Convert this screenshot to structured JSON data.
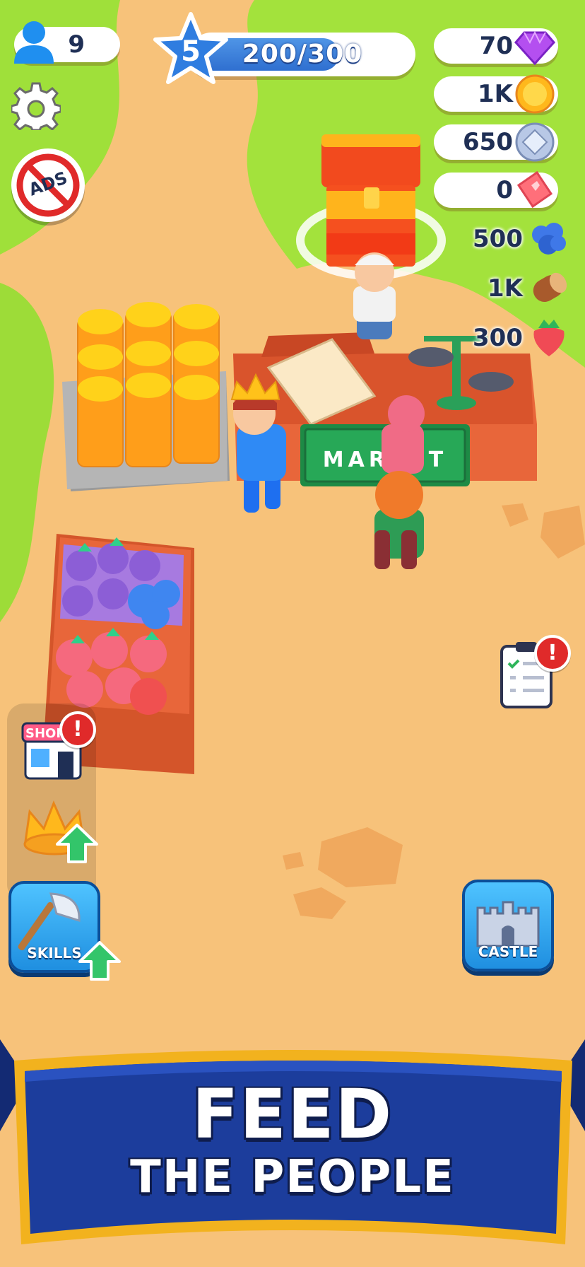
{
  "hud": {
    "player_count": "9",
    "level": "5",
    "xp_text": "200/300",
    "xp_progress": 0.67,
    "gems": "70",
    "coins": "1K",
    "silver": "650",
    "tickets": "0",
    "blueberries": "500",
    "wood": "1K",
    "strawberries": "300"
  },
  "buttons": {
    "ads_label": "ADS",
    "shop_label": "SHOP",
    "skills_label": "SKILLS",
    "castle_label": "CASTLE"
  },
  "world": {
    "market_sign": "MARKET"
  },
  "banner": {
    "line1": "FEED",
    "line2": "THE PEOPLE"
  },
  "colors": {
    "ground": "#f7c27a",
    "grass": "#9fe03a",
    "banner_blue": "#1c3d9c",
    "banner_gold": "#f2b21e",
    "button_blue": "#2fa4f0",
    "alert_red": "#e02a2a"
  }
}
